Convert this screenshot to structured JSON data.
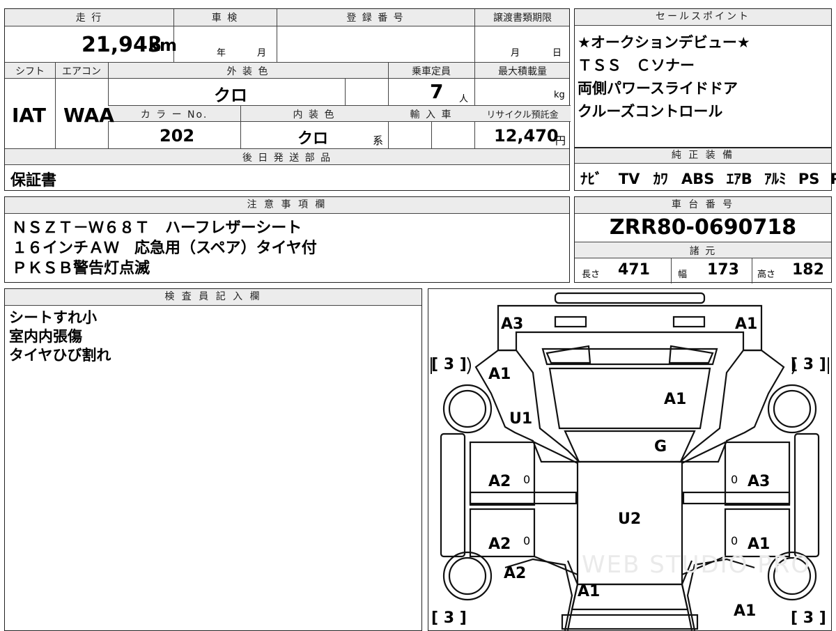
{
  "mileage": {
    "header": "走 行",
    "value": "21,943",
    "unit": "km"
  },
  "inspection": {
    "header": "車 検",
    "year_label": "年",
    "month_label": "月"
  },
  "registration": {
    "header": "登 録 番 号"
  },
  "transfer": {
    "header": "譲渡書類期限",
    "month_label": "月",
    "day_label": "日"
  },
  "shift": {
    "header": "シフト",
    "value": "IAT"
  },
  "aircon": {
    "header": "エアコン",
    "value": "WAA"
  },
  "exterior": {
    "header": "外 装 色",
    "value": "クロ"
  },
  "capacity": {
    "header": "乗車定員",
    "value": "7",
    "unit": "人"
  },
  "max_load": {
    "header": "最大積載量",
    "unit": "kg"
  },
  "color_no": {
    "header": "カ ラ ー No.",
    "value": "202"
  },
  "interior": {
    "header": "内 装 色",
    "value": "クロ",
    "suffix": "系"
  },
  "import": {
    "header": "輸 入 車"
  },
  "recycle": {
    "header": "リサイクル預託金",
    "value": "12,470",
    "unit": "円"
  },
  "later_parts": {
    "header": "後 日 発 送 部 品",
    "value": "保証書"
  },
  "sales_points": {
    "header": "セールスポイント",
    "lines": [
      "★オークションデビュー★",
      "ＴＳＳ　Ｃソナー",
      "両側パワースライドドア",
      "クルーズコントロール"
    ]
  },
  "equipment": {
    "header": "純 正 装 備",
    "items": [
      "ﾅﾋﾞ",
      "TV",
      "ｶﾜ",
      "ABS",
      "ｴｱB",
      "ｱﾙﾐ",
      "PS",
      "PW"
    ]
  },
  "notes": {
    "header": "注 意 事 項 欄",
    "lines": [
      "ＮＳＺＴ－Ｗ６８Ｔ　ハーフレザーシート",
      "１６インチＡＷ　応急用（スペア）タイヤ付",
      "ＰＫＳＢ警告灯点滅"
    ]
  },
  "chassis": {
    "header": "車 台 番 号",
    "value": "ZRR80-0690718"
  },
  "specs": {
    "header": "諸 元",
    "length_label": "長さ",
    "length": "471",
    "width_label": "幅",
    "width": "173",
    "height_label": "高さ",
    "height": "182"
  },
  "inspector": {
    "header": "検 査 員 記 入 欄",
    "lines": [
      "シートすれ小",
      "室内内張傷",
      "タイヤひび割れ"
    ]
  },
  "car_diagram": {
    "marks": {
      "rear_left": "A3",
      "rear_right": "A1",
      "back_door": "A1",
      "left_quarter_upper": "A1",
      "left_quarter": "U1",
      "roof_glass": "G",
      "left_rear_door": "A2",
      "right_rear_door": "A3",
      "roof": "U2",
      "left_front_door": "A2",
      "right_front_door": "A1",
      "left_fender": "A2",
      "hood": "A1",
      "right_fender": "A1"
    },
    "tires": {
      "rear_left": "3",
      "rear_right": "3",
      "front_left": "3",
      "front_right": "3"
    },
    "zero_marks": "0",
    "watermark": "WEB STUDIO PRO"
  }
}
